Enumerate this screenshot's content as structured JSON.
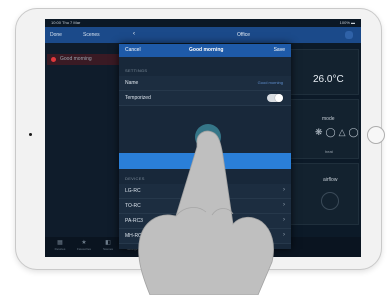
{
  "status_bar": {
    "time": "10:00 Thu 7 Mar",
    "battery": "100% ▬"
  },
  "left_pane": {
    "header_items": [
      "Done",
      "Scenes"
    ],
    "scene_name": "Good morning"
  },
  "right_pane": {
    "back": "‹",
    "title": "Office",
    "temperature": "26.0°C",
    "mode_label": "mode",
    "mode_icons": "❋◯△◯",
    "mode_sub": "heat",
    "airflow_label": "airflow"
  },
  "modal": {
    "cancel": "Cancel",
    "title": "Good morning",
    "save": "Save",
    "settings_section": "SETTINGS",
    "name_label": "Name",
    "name_value": "Good morning",
    "temporized_label": "Temporized",
    "temporized_on": true,
    "add_icon": "+",
    "devices_section": "DEVICES",
    "devices": [
      {
        "name": "LG-RC"
      },
      {
        "name": "TO-RC"
      },
      {
        "name": "PA-RC3"
      },
      {
        "name": "MH-RC"
      }
    ],
    "chevron": "›"
  },
  "tab_bar": {
    "tabs": [
      {
        "icon": "▦",
        "label": "Devices"
      },
      {
        "icon": "★",
        "label": "Favourites"
      },
      {
        "icon": "◧",
        "label": "Scenes"
      },
      {
        "icon": "⚙",
        "label": "Settings"
      }
    ]
  },
  "colors": {
    "accent": "#1e5aa8",
    "button": "#2a7fd8",
    "scene_dot": "#e0383c",
    "screen_bg": "#0b1826"
  }
}
